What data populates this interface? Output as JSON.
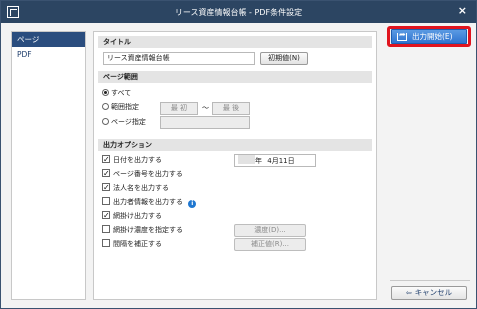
{
  "window": {
    "title": "リース資産情報台帳 - PDF条件設定",
    "close_glyph": "×"
  },
  "sidebar": {
    "items": [
      {
        "label": "ページ",
        "active": true
      },
      {
        "label": "PDF",
        "active": false
      }
    ]
  },
  "title_section": {
    "header": "タイトル",
    "value": "リース資産情報台帳",
    "reset_label": "初期値(N)"
  },
  "page_range": {
    "header": "ページ範囲",
    "options": {
      "all": "すべて",
      "range": "範囲指定",
      "pages": "ページ指定"
    },
    "range_from": "最 初",
    "range_sep": "〜",
    "range_to": "最 後"
  },
  "output_options": {
    "header": "出力オプション",
    "date": {
      "label": "日付を出力する",
      "checked": true,
      "value_year_label": "年",
      "value_date": "4月11日"
    },
    "page_no": {
      "label": "ページ番号を出力する",
      "checked": true
    },
    "corp_name": {
      "label": "法人名を出力する",
      "checked": true
    },
    "author": {
      "label": "出力者情報を出力する",
      "checked": false
    },
    "shading": {
      "label": "網掛け出力する",
      "checked": true
    },
    "shading_density": {
      "label": "網掛け濃度を指定する",
      "checked": false,
      "button": "濃度(D)..."
    },
    "spacing": {
      "label": "間隔を補正する",
      "checked": false,
      "button": "補正値(R)..."
    }
  },
  "actions": {
    "start_label": "出力開始(E)",
    "cancel_label": "キャンセル"
  }
}
